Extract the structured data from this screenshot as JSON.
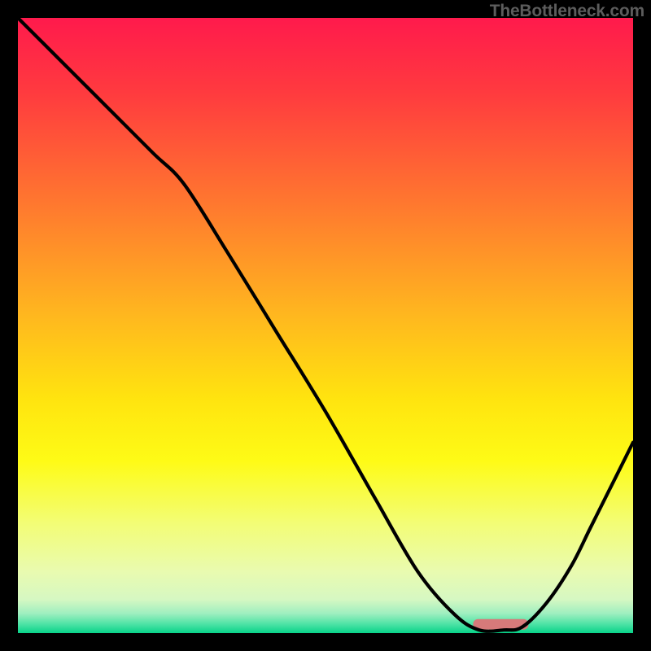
{
  "attribution": "TheBottleneck.com",
  "chart_data": {
    "type": "line",
    "title": "",
    "xlabel": "",
    "ylabel": "",
    "xlim": [
      0,
      100
    ],
    "ylim": [
      0,
      100
    ],
    "gradient_stops": [
      {
        "t": 0.0,
        "color": "#ff1a4c"
      },
      {
        "t": 0.12,
        "color": "#ff3a3f"
      },
      {
        "t": 0.3,
        "color": "#ff772f"
      },
      {
        "t": 0.48,
        "color": "#ffb61f"
      },
      {
        "t": 0.62,
        "color": "#ffe40f"
      },
      {
        "t": 0.72,
        "color": "#fefb16"
      },
      {
        "t": 0.82,
        "color": "#f3fd74"
      },
      {
        "t": 0.9,
        "color": "#e9fbb0"
      },
      {
        "t": 0.945,
        "color": "#d6f8c2"
      },
      {
        "t": 0.968,
        "color": "#9fefc0"
      },
      {
        "t": 0.985,
        "color": "#4fe3a6"
      },
      {
        "t": 1.0,
        "color": "#08d389"
      }
    ],
    "series": [
      {
        "name": "bottleneck-curve",
        "x": [
          0,
          8,
          15,
          22,
          27,
          34,
          42,
          50,
          58,
          65,
          71,
          75,
          79,
          82,
          86,
          90,
          93,
          96,
          100
        ],
        "y": [
          100,
          92,
          85,
          78,
          73,
          62,
          49,
          36,
          22,
          10,
          3,
          0.5,
          0.5,
          1,
          5,
          11,
          17,
          23,
          31
        ]
      }
    ],
    "marker": {
      "x_start": 74,
      "x_end": 83,
      "y": 1.5,
      "color": "#d67a7a"
    }
  }
}
